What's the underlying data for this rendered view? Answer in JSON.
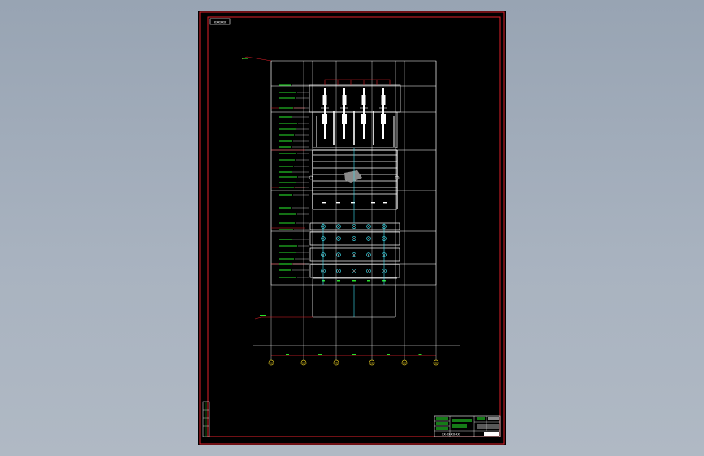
{
  "sheet": {
    "title_tag": "XXXXXX",
    "axis_labels": [
      "(1)",
      "(2)",
      "(3)",
      "(4)",
      "(5)",
      "(6)"
    ],
    "title_block": {
      "caption": "XX-XX-XX-XX"
    }
  },
  "colors": {
    "background": "#a3adba",
    "sheet": "#000000",
    "border": "#e0202a",
    "lines": "#ffffff",
    "annotation": "#27e02a",
    "axis_bubble": "#d8c020",
    "leader": "#e0202a",
    "bolt": "#3fe0f0"
  }
}
